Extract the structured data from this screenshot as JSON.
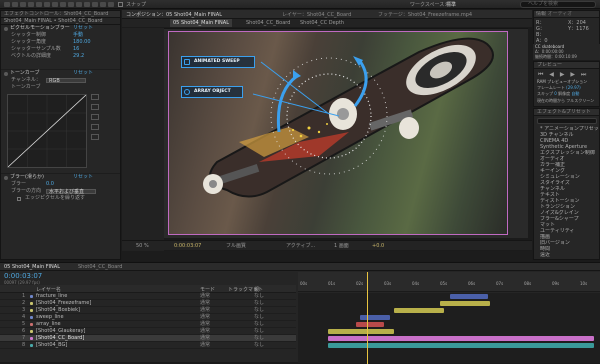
{
  "toolbar": {
    "label": "スナップ",
    "workspace": "ワークスペース：",
    "workspace_value": "標準",
    "search_placeholder": "ヘルプを検索"
  },
  "effect_panel": {
    "tab_label": "エフェクトコントロール：Shot04_CC_Board",
    "breadcrumb": "Shot04_Main FINAL • Shot04_CC_Board",
    "effects": [
      {
        "name": "ピクセルモーションブラー",
        "value": "リセット",
        "sub": [
          {
            "label": "シャッター制御",
            "value": "手動"
          },
          {
            "label": "シャッター角度",
            "value": "180.00"
          },
          {
            "label": "シャッターサンプル数",
            "value": "16"
          },
          {
            "label": "ベクトルの詳細度",
            "value": "29.2"
          }
        ]
      },
      {
        "name": "トーンカーブ",
        "value": "リセット",
        "sub": [
          {
            "label": "チャンネル：",
            "value": "RGB"
          },
          {
            "label": "トーンカーブ",
            "value": ""
          }
        ]
      },
      {
        "name": "ブラー(滑らか)",
        "value": "リセット",
        "sub": [
          {
            "label": "ブラー",
            "value": "0.0"
          },
          {
            "label": "ブラーの方向",
            "value": "水平および垂直"
          },
          {
            "label": "",
            "value": "エッジピクセルを繰り返す"
          }
        ]
      }
    ]
  },
  "viewer": {
    "tab_comp": "コンポジション：05 Shot04_Main FINAL",
    "tab_layer": "レイヤー：Shot04_CC_Board",
    "tab_footage": "フッテージ：Shot04_Freezeframe.mp4",
    "subtabs": [
      "05 Shot04_Main FINAL",
      "Shot04_CC_Board",
      "Shot04_CC Depth"
    ],
    "callout_1": "ANIMATED SWEEP",
    "callout_2": "ARRAY OBJECT",
    "controls": {
      "zoom": "50 %",
      "timecode": "0:00:03:07",
      "res": "フル画質",
      "camera": "アクティブ...",
      "views": "1 画面",
      "exposure": "+0.0"
    }
  },
  "info_panel": {
    "tab_1": "情報",
    "tab_2": "オーディオ",
    "r": "R：",
    "g": "G：",
    "b": "B：",
    "a": "A：0",
    "x": "X：204",
    "y": "Y：1176",
    "comp_name": "CC skateboard",
    "delta": "Δ：0:00:00:00",
    "duration": "継続時間：0:00:10:09"
  },
  "preview_panel": {
    "title": "プレビュー",
    "ram_label": "RAM プレビューオプション",
    "frame_rate_label": "フレームレート",
    "frame_rate": "(29.97)",
    "skip_label": "スキップ",
    "skip": "0",
    "resolution_label": "解像度",
    "resolution": "自動",
    "from_current": "現在の時間から",
    "full_screen": "フルスクリーン"
  },
  "effects_presets": {
    "title": "エフェクト&プリセット",
    "search_placeholder": "",
    "items": [
      "* アニメーションプリセット",
      "3D チャンネル",
      "CINEMA 4D",
      "Synthetic Aperture",
      "エクスプレッション制御",
      "オーディオ",
      "カラー補正",
      "キーイング",
      "シミュレーション",
      "スタイライズ",
      "チャンネル",
      "テキスト",
      "ディストーション",
      "トランジション",
      "ノイズ&グレイン",
      "ブラー&シャープ",
      "マット",
      "ユーティリティ",
      "描画",
      "旧バージョン",
      "時間",
      "遠近"
    ]
  },
  "timeline": {
    "tabs": [
      "05 Shot04_Main FINAL",
      "Shot04_CC_Board"
    ],
    "timecode": "0:00:03:07",
    "frame_info": "00097 (29.97 fps)",
    "col_layer": "レイヤー名",
    "col_mode": "モード",
    "col_trkmat": "トラックマット",
    "col_parent": "親",
    "ruler_labels": [
      "00s",
      "01s",
      "02s",
      "03s",
      "04s",
      "05s",
      "06s",
      "07s",
      "08s",
      "09s",
      "10s"
    ],
    "layers": [
      {
        "num": "1",
        "name": "fracture_line",
        "mode": "通常",
        "parent": "なし",
        "color": "#6f86c9"
      },
      {
        "num": "2",
        "name": "[Shot04_Freezeframe]",
        "mode": "通常",
        "parent": "なし",
        "color": "#c9c56f"
      },
      {
        "num": "3",
        "name": "[Shot04_Boxbiek]",
        "mode": "通常",
        "parent": "なし",
        "color": "#c9c56f"
      },
      {
        "num": "4",
        "name": "sweep_line",
        "mode": "通常",
        "parent": "なし",
        "color": "#6f86c9"
      },
      {
        "num": "5",
        "name": "array_line",
        "mode": "通常",
        "parent": "なし",
        "color": "#c96f6f"
      },
      {
        "num": "6",
        "name": "[Shot04_Glaukeray]",
        "mode": "通常",
        "parent": "なし",
        "color": "#c9c56f"
      },
      {
        "num": "7",
        "name": "[Shot04_CC_Board]",
        "mode": "通常",
        "parent": "なし",
        "color": "#d07ad0"
      },
      {
        "num": "8",
        "name": "[Shot04_BG]",
        "mode": "通常",
        "parent": "なし",
        "color": "#4aa8a8"
      }
    ],
    "colors": {
      "accent": "#4fa8e0",
      "playhead": "#e8c440"
    }
  }
}
